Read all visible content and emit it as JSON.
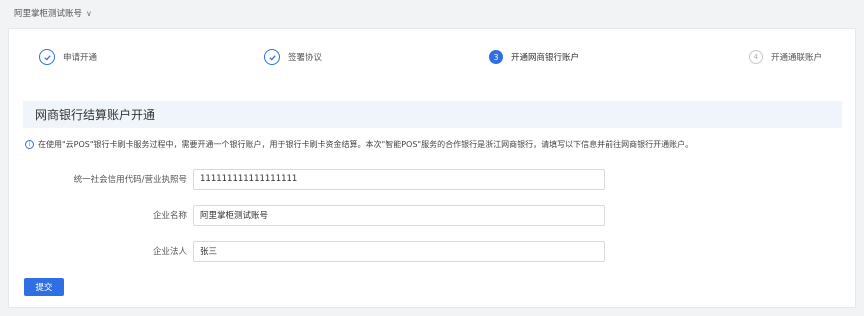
{
  "account": {
    "name": "阿里掌柜测试账号",
    "chevron_icon": "chevron-down-icon"
  },
  "steps": [
    {
      "label": "申请开通",
      "state": "done",
      "icon": "check-icon"
    },
    {
      "label": "签署协议",
      "state": "done",
      "icon": "check-icon"
    },
    {
      "label": "开通网商银行账户",
      "state": "active",
      "number": "3"
    },
    {
      "label": "开通通联账户",
      "state": "todo",
      "number": "4"
    }
  ],
  "section": {
    "title": "网商银行结算账户开通",
    "notice": "在使用\"云POS\"银行卡刷卡服务过程中，需要开通一个银行账户，用于银行卡刷卡资金结算。本次\"智能POS\"服务的合作银行是浙江网商银行，请填写以下信息并前往网商银行开通账户。"
  },
  "form": {
    "license_label": "统一社会信用代码/营业执照号",
    "license_value": "111111111111111111",
    "company_label": "企业名称",
    "company_value": "阿里掌柜测试账号",
    "legal_label": "企业法人",
    "legal_value": "张三",
    "submit_label": "提交"
  },
  "colors": {
    "primary": "#2f6fe4",
    "page_bg": "#f2f3f5",
    "section_bg": "#f0f4fb"
  }
}
